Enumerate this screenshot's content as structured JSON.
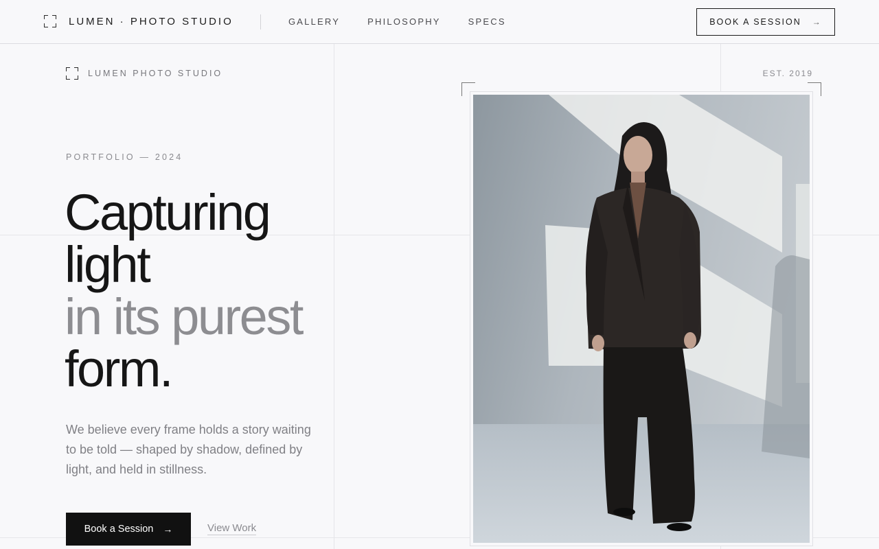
{
  "nav": {
    "brand": "LUMEN · PHOTO STUDIO",
    "links": [
      "GALLERY",
      "PHILOSOPHY",
      "SPECS"
    ],
    "cta_label": "BOOK A SESSION"
  },
  "hero": {
    "brand_small": "LUMEN PHOTO STUDIO",
    "established": "EST. 2019",
    "eyebrow": "PORTFOLIO — 2024",
    "headline": {
      "line1": "Capturing",
      "line2": "light",
      "line3_muted": "in its purest",
      "line4": "form."
    },
    "description": "We believe every frame holds a story waiting to be told — shaped by shadow, defined by light, and held in stillness.",
    "primary_cta": "Book a Session",
    "secondary_cta": "View Work"
  },
  "icons": {
    "logo": "viewfinder-corners-icon",
    "arrow": "arrow-right-icon"
  },
  "colors": {
    "background": "#f8f8fa",
    "text": "#161616",
    "muted": "#8d8d91",
    "button": "#111111"
  }
}
